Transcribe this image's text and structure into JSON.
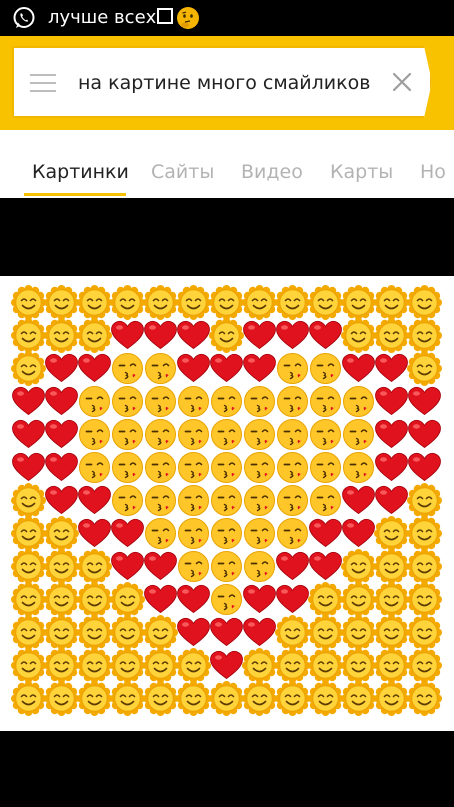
{
  "status_bar": {
    "app_icon": "whatsapp-icon",
    "title": "лучше всех",
    "trailing_icons": [
      "empty-box-icon",
      "thinking-face-icon"
    ]
  },
  "search": {
    "query": "на картине много смайликов",
    "menu_icon": "hamburger-menu-icon",
    "clear_icon": "close-icon",
    "accent_color": "#f8c200"
  },
  "tabs": [
    {
      "label": "Картинки",
      "active": true
    },
    {
      "label": "Сайты",
      "active": false
    },
    {
      "label": "Видео",
      "active": false
    },
    {
      "label": "Карты",
      "active": false
    },
    {
      "label": "Но",
      "active": false
    }
  ],
  "image": {
    "description_kind": "emoji mosaic",
    "grid_legend": {
      "S": "sun-smiley-icon",
      "H": "red-heart-icon",
      "K": "kissing-face-icon"
    },
    "grid_rows": [
      "SSSSSSSSSSSSS",
      "SSSHHHSHHHSSS",
      "SHHKKHHHKKHHS",
      "HHKKKKKKKKKHH",
      "HHKKKKKKKKKHH",
      "HHKKKKKKKKKHH",
      "SHHKKKKKKKHHS",
      "SSHHKKKKKHHSS",
      "SSSHHKKKHHSSS",
      "SSSSHHKHHSSSS",
      "SSSSSHHHSSSSS",
      "SSSSSSHSSSSSS",
      "SSSSSSSSSSSSS"
    ]
  }
}
